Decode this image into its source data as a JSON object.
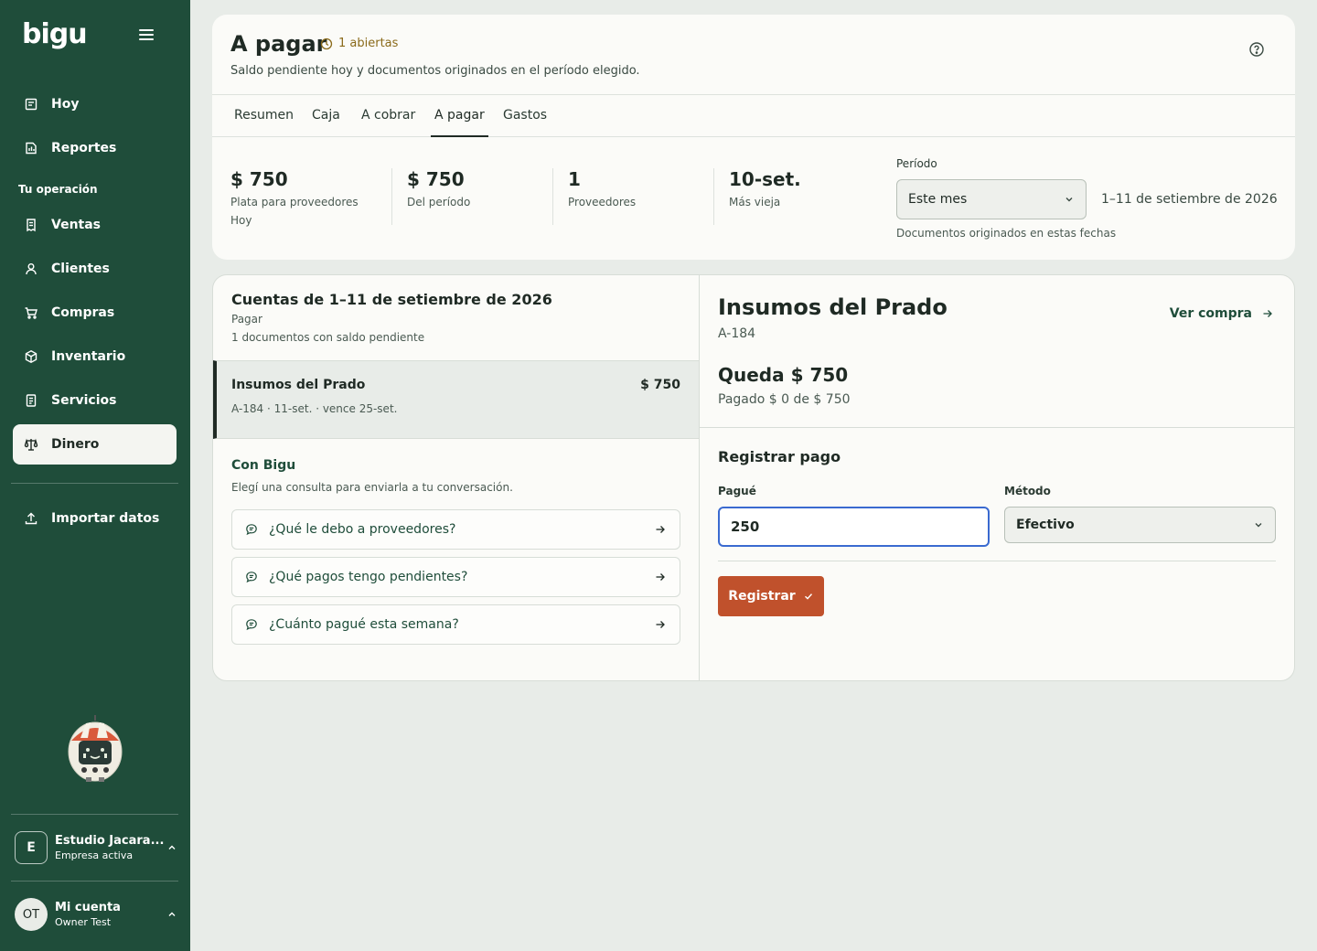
{
  "sidebar": {
    "logo": "bigu",
    "items": [
      {
        "label": "Hoy",
        "icon": "calendar-icon"
      },
      {
        "label": "Reportes",
        "icon": "report-icon"
      },
      {
        "label": "Ventas",
        "icon": "receipt-icon"
      },
      {
        "label": "Clientes",
        "icon": "user-icon"
      },
      {
        "label": "Compras",
        "icon": "cart-icon"
      },
      {
        "label": "Inventario",
        "icon": "box-icon"
      },
      {
        "label": "Servicios",
        "icon": "document-icon"
      },
      {
        "label": "Dinero",
        "icon": "scale-icon",
        "active": true
      },
      {
        "label": "Importar datos",
        "icon": "upload-icon"
      }
    ],
    "section_label": "Tu operación",
    "company": {
      "initial": "E",
      "name": "Estudio Jacara...",
      "status": "Empresa activa"
    },
    "account": {
      "initials": "OT",
      "title": "Mi cuenta",
      "name": "Owner Test"
    }
  },
  "header": {
    "title": "A pagar",
    "badge": "1 abiertas",
    "subtitle": "Saldo pendiente hoy y documentos originados en el período elegido.",
    "tabs": [
      {
        "label": "Resumen"
      },
      {
        "label": "Caja"
      },
      {
        "label": "A cobrar"
      },
      {
        "label": "A pagar",
        "active": true
      },
      {
        "label": "Gastos"
      }
    ],
    "stats": [
      {
        "value": "$ 750",
        "label": "Plata para proveedores",
        "sub": "Hoy"
      },
      {
        "value": "$ 750",
        "label": "Del período"
      },
      {
        "value": "1",
        "label": "Proveedores"
      },
      {
        "value": "10-set.",
        "label": "Más vieja"
      }
    ],
    "period": {
      "label": "Período",
      "selected": "Este mes",
      "range": "1–11 de setiembre de 2026",
      "help": "Documentos originados en estas fechas"
    }
  },
  "list": {
    "title": "Cuentas de 1–11 de setiembre de 2026",
    "kind": "Pagar",
    "count": "1 documentos con saldo pendiente",
    "rows": [
      {
        "name": "Insumos del Prado",
        "amount": "$ 750",
        "meta": "A-184 · 11-set. · vence 25-set."
      }
    ]
  },
  "bigu": {
    "title": "Con Bigu",
    "subtitle": "Elegí una consulta para enviarla a tu conversación.",
    "queries": [
      {
        "label": "¿Qué le debo a proveedores?"
      },
      {
        "label": "¿Qué pagos tengo pendientes?"
      },
      {
        "label": "¿Cuánto pagué esta semana?"
      }
    ]
  },
  "detail": {
    "supplier": "Insumos del Prado",
    "code": "A-184",
    "view_link": "Ver compra",
    "remaining": "Queda $ 750",
    "paid": "Pagado $ 0 de $ 750",
    "form": {
      "title": "Registrar pago",
      "amount_label": "Pagué",
      "amount_value": "250",
      "method_label": "Método",
      "method_value": "Efectivo",
      "submit": "Registrar"
    }
  },
  "colors": {
    "sidebar": "#1f4d3a",
    "accent": "#c0512c",
    "focus": "#3a6ad0",
    "badge": "#8a6a1a"
  }
}
